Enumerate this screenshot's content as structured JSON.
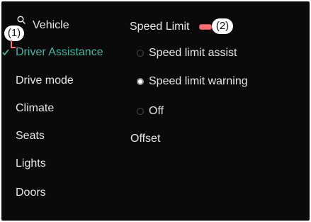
{
  "header": {
    "vehicle_label": "Vehicle",
    "section_title": "Speed Limit"
  },
  "callouts": {
    "first": "(1)",
    "second": "(2)"
  },
  "sidebar": {
    "items": [
      {
        "label": "Driver Assistance",
        "active": true
      },
      {
        "label": "Drive mode"
      },
      {
        "label": "Climate"
      },
      {
        "label": "Seats"
      },
      {
        "label": "Lights"
      },
      {
        "label": "Doors"
      }
    ]
  },
  "speed_limit": {
    "options": [
      {
        "label": "Speed limit assist",
        "selected": false
      },
      {
        "label": "Speed limit warning",
        "selected": true
      },
      {
        "label": "Off",
        "selected": false
      }
    ],
    "offset_label": "Offset"
  },
  "colors": {
    "accent": "#3fb8a4",
    "background": "#0a0a0a",
    "text": "#e6e6e6",
    "callout_marker": "#ff6f6f"
  },
  "icons": {
    "search": "search-icon",
    "check": "check-icon"
  }
}
